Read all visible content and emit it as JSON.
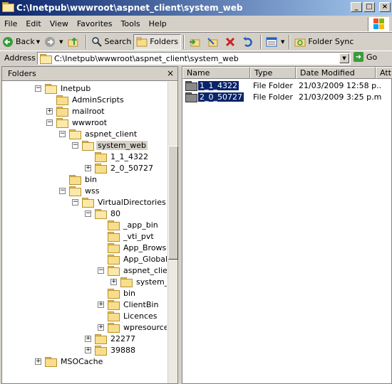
{
  "window": {
    "title": "C:\\Inetpub\\wwwroot\\aspnet_client\\system_web"
  },
  "menu": [
    "File",
    "Edit",
    "View",
    "Favorites",
    "Tools",
    "Help"
  ],
  "toolbar": {
    "back": "Back",
    "search": "Search",
    "folders": "Folders",
    "folder_sync": "Folder Sync"
  },
  "address": {
    "label": "Address",
    "value": "C:\\Inetpub\\wwwroot\\aspnet_client\\system_web",
    "go": "Go"
  },
  "folders_pane": {
    "title": "Folders",
    "close": "×",
    "tree": [
      {
        "label": "Inetpub",
        "exp": "−"
      },
      {
        "label": "AdminScripts",
        "exp": ""
      },
      {
        "label": "mailroot",
        "exp": "+"
      },
      {
        "label": "wwwroot",
        "exp": "−"
      },
      {
        "label": "aspnet_client",
        "exp": "−"
      },
      {
        "label": "system_web",
        "exp": "−"
      },
      {
        "label": "1_1_4322",
        "exp": ""
      },
      {
        "label": "2_0_50727",
        "exp": "+"
      },
      {
        "label": "bin",
        "exp": ""
      },
      {
        "label": "wss",
        "exp": "−"
      },
      {
        "label": "VirtualDirectories",
        "exp": "−"
      },
      {
        "label": "80",
        "exp": "−"
      },
      {
        "label": "_app_bin",
        "exp": ""
      },
      {
        "label": "_vti_pvt",
        "exp": ""
      },
      {
        "label": "App_Browsers",
        "exp": ""
      },
      {
        "label": "App_GlobalRe",
        "exp": ""
      },
      {
        "label": "aspnet_client",
        "exp": "−"
      },
      {
        "label": "system_w",
        "exp": "+"
      },
      {
        "label": "bin",
        "exp": ""
      },
      {
        "label": "ClientBin",
        "exp": "+"
      },
      {
        "label": "Licences",
        "exp": ""
      },
      {
        "label": "wpresources",
        "exp": "+"
      },
      {
        "label": "22277",
        "exp": "+"
      },
      {
        "label": "39888",
        "exp": "+"
      },
      {
        "label": "MSOCache",
        "exp": "+"
      }
    ]
  },
  "list": {
    "columns": [
      "Name",
      "Type",
      "Date Modified",
      "Attr"
    ],
    "rows": [
      {
        "name": "1_1_4322",
        "type": "File Folder",
        "date": "21/03/2009 12:58 p..."
      },
      {
        "name": "2_0_50727",
        "type": "File Folder",
        "date": "21/03/2009 3:25 p.m."
      }
    ]
  },
  "colors": {
    "title_start": "#0a246a",
    "title_end": "#a6caf0",
    "selection": "#0a246a",
    "chrome": "#d4d0c8"
  }
}
